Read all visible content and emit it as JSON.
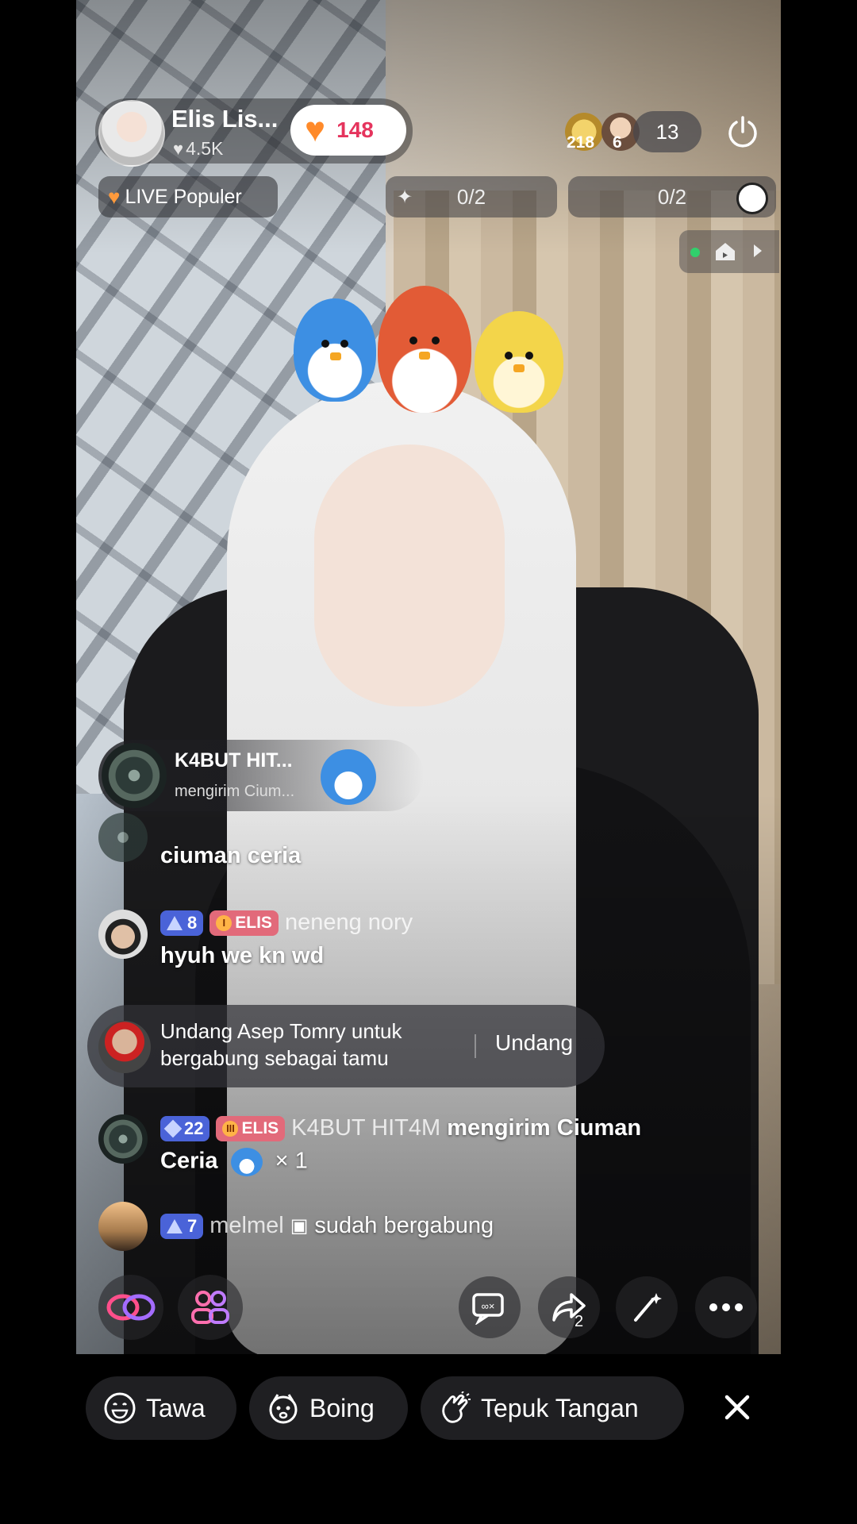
{
  "host": {
    "name": "Elis Lis...",
    "likes": "4.5K",
    "follow_count": "148"
  },
  "viewers": {
    "badge1": "218",
    "badge2": "6",
    "count": "13"
  },
  "tag": "LIVE Populer",
  "goals": [
    {
      "value": "0/2"
    },
    {
      "value": "0/2"
    }
  ],
  "gift_banner": {
    "user": "K4BUT HIT...",
    "action": "mengirim Cium..."
  },
  "chat": [
    {
      "text": "ciuman ceria"
    },
    {
      "level": "8",
      "fan": "ELIS",
      "user": "neneng nory",
      "text": "hyuh we kn wd"
    },
    {
      "level": "22",
      "fan": "ELIS",
      "user": "K4BUT HIT4M",
      "text1": "mengirim Ciuman",
      "text2": "Ceria",
      "multiplier": "× 1"
    },
    {
      "level": "7",
      "user": "melmel",
      "text": "sudah bergabung"
    }
  ],
  "invite": {
    "text_line1": "Undang Asep Tomry untuk",
    "text_line2": "bergabung sebagai tamu",
    "button": "Undang"
  },
  "share_count": "2",
  "reactions": [
    {
      "label": "Tawa"
    },
    {
      "label": "Boing"
    },
    {
      "label": "Tepuk Tangan"
    }
  ],
  "colors": {
    "level_badge": "#4a63d8",
    "fan_badge": "#e26a7a",
    "follow_heart": "#ff8a2a",
    "follow_number": "#e5345d"
  }
}
